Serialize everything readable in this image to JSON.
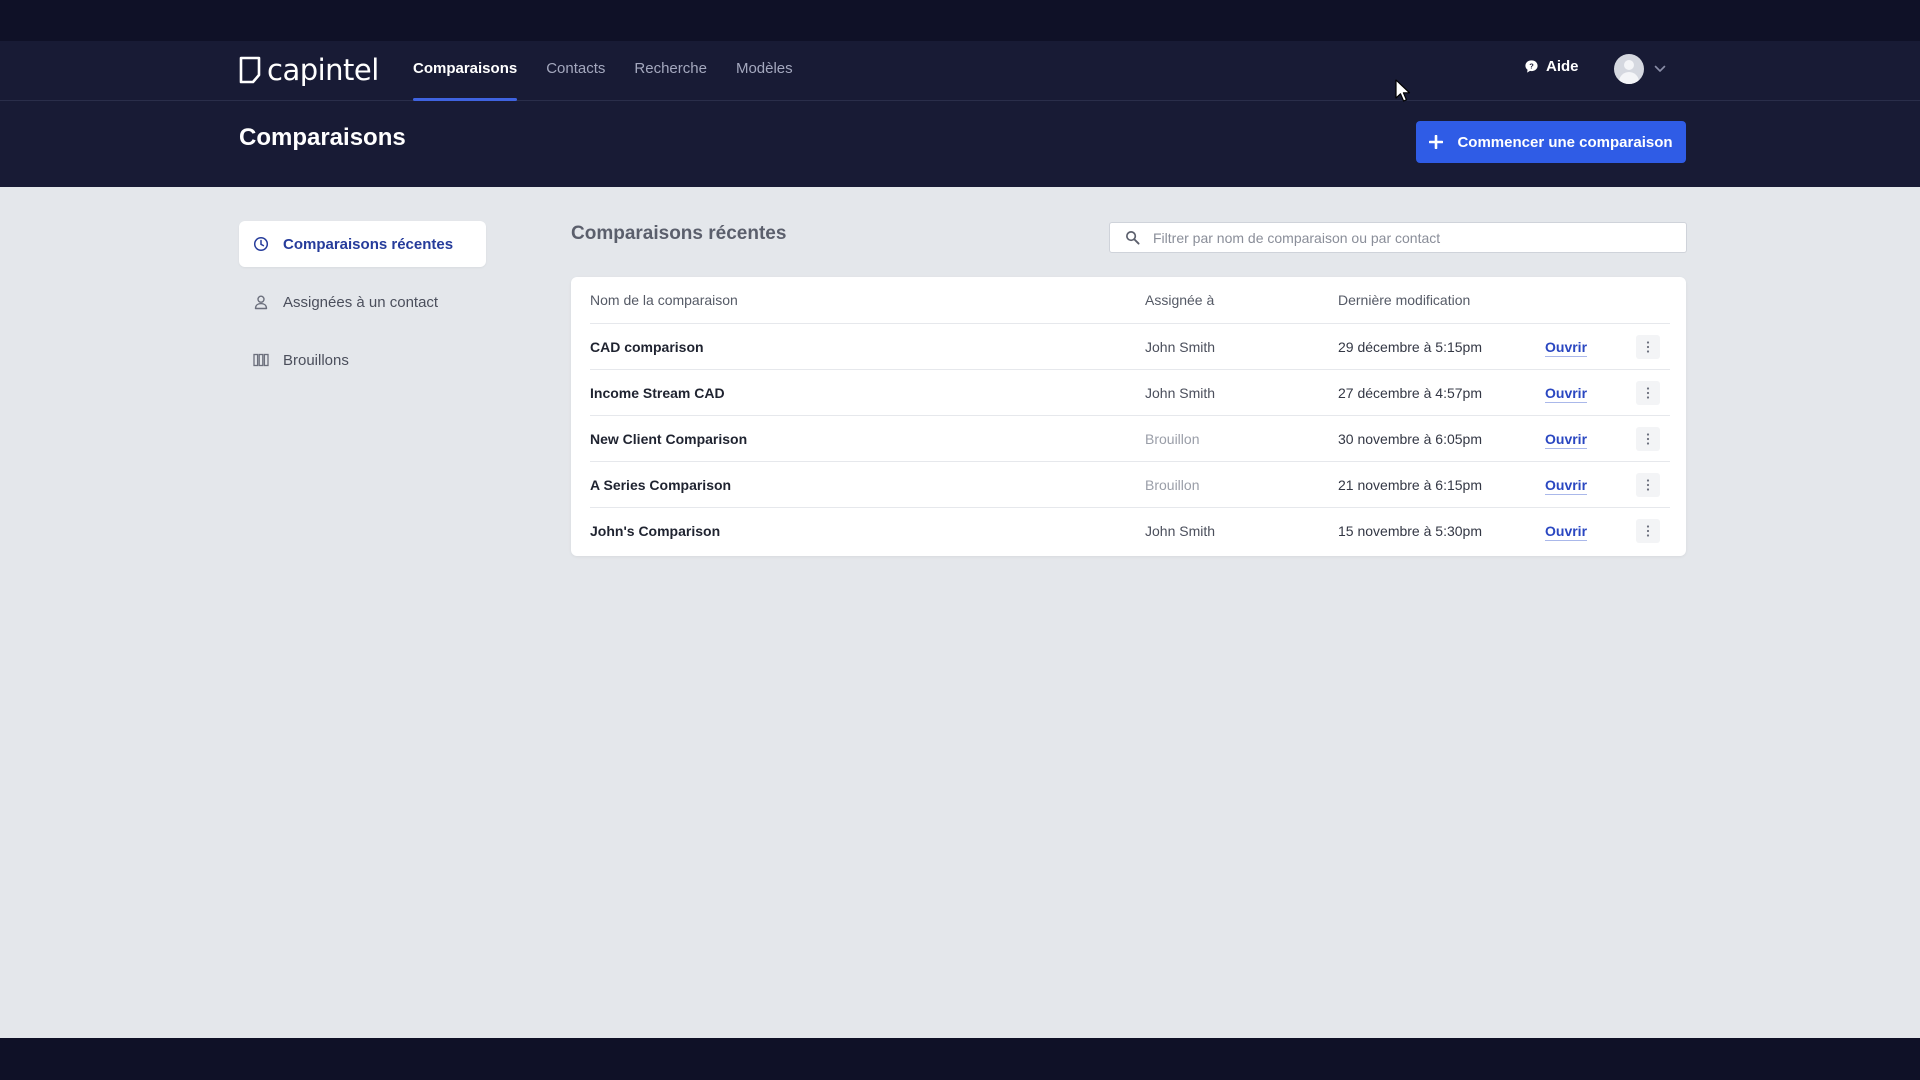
{
  "brand": {
    "name": "capintel"
  },
  "nav": {
    "items": [
      {
        "label": "Comparaisons",
        "active": true
      },
      {
        "label": "Contacts",
        "active": false
      },
      {
        "label": "Recherche",
        "active": false
      },
      {
        "label": "Modèles",
        "active": false
      }
    ],
    "help_label": "Aide"
  },
  "page": {
    "title": "Comparaisons",
    "primary_action": "Commencer une comparaison"
  },
  "sidebar": {
    "items": [
      {
        "label": "Comparaisons récentes",
        "icon": "clock-icon",
        "active": true
      },
      {
        "label": "Assignées à un contact",
        "icon": "user-icon",
        "active": false
      },
      {
        "label": "Brouillons",
        "icon": "columns-icon",
        "active": false
      }
    ]
  },
  "main": {
    "section_title": "Comparaisons récentes",
    "search": {
      "placeholder": "Filtrer par nom de comparaison ou par contact",
      "value": ""
    },
    "table": {
      "headers": {
        "name": "Nom de la comparaison",
        "assigned": "Assignée à",
        "modified": "Dernière modification"
      },
      "rows": [
        {
          "name": "CAD comparison",
          "assigned": "John Smith",
          "draft": false,
          "modified": "29 décembre à 5:15pm",
          "action": "Ouvrir"
        },
        {
          "name": "Income Stream CAD",
          "assigned": "John Smith",
          "draft": false,
          "modified": "27 décembre à 4:57pm",
          "action": "Ouvrir"
        },
        {
          "name": "New Client Comparison",
          "assigned": "Brouillon",
          "draft": true,
          "modified": "30 novembre à 6:05pm",
          "action": "Ouvrir"
        },
        {
          "name": "A Series Comparison",
          "assigned": "Brouillon",
          "draft": true,
          "modified": "21 novembre à 6:15pm",
          "action": "Ouvrir"
        },
        {
          "name": "John's Comparison",
          "assigned": "John Smith",
          "draft": false,
          "modified": "15 novembre à 5:30pm",
          "action": "Ouvrir"
        }
      ]
    }
  },
  "colors": {
    "header_bg": "#181b35",
    "accent": "#2f5ce6",
    "link": "#2a47c1",
    "content_bg": "#e4e7eb"
  }
}
